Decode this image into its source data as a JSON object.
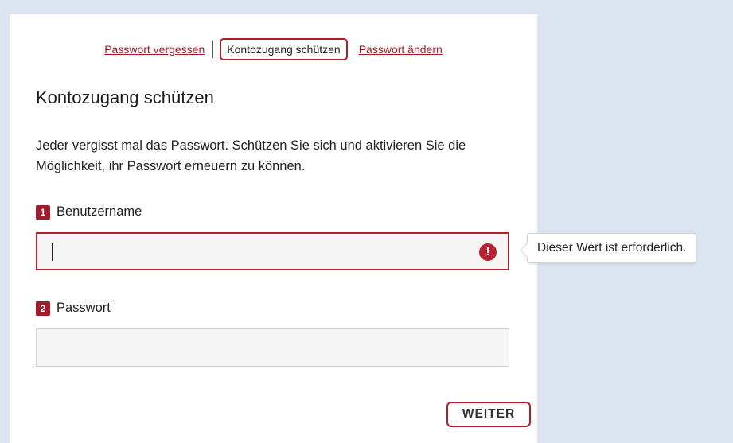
{
  "tabs": {
    "forgot_password": "Passwort vergessen",
    "protect_access": "Kontozugang schützen",
    "change_password": "Passwort ändern"
  },
  "page": {
    "title": "Kontozugang schützen",
    "intro": "Jeder vergisst mal das Passwort. Schützen Sie sich und aktivieren Sie die Möglichkeit, ihr Passwort erneuern zu können."
  },
  "fields": {
    "username": {
      "number": "1",
      "label": "Benutzername",
      "value": "",
      "error_symbol": "!"
    },
    "password": {
      "number": "2",
      "label": "Passwort",
      "value": ""
    }
  },
  "tooltip": {
    "text": "Dieser Wert ist erforderlich."
  },
  "actions": {
    "next_label": "WEITER"
  },
  "colors": {
    "accent": "#b01c2a",
    "background": "#dde5f3"
  }
}
